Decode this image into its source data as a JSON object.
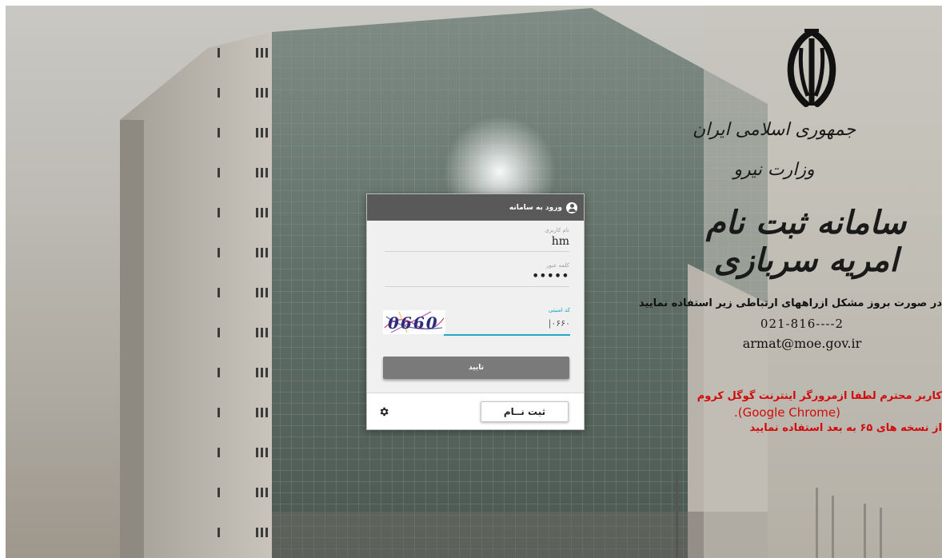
{
  "branding": {
    "republic": "جمهوری اسلامی ایران",
    "ministry": "وزارت نیرو",
    "system_title": "سامانه ثبت نام امریه سربازی",
    "emblem_icon": "iran-emblem-icon"
  },
  "help": {
    "message": "در صورت بروز مشکل ازراههای ارتباطی زیر استفاده نمایید",
    "phone": "021-816----2",
    "email": "armat@moe.gov.ir"
  },
  "warning": {
    "line1": "کاربر محترم لطفا ازمرورگر اینترنت گوگل کروم",
    "line2": ".(Google Chrome)",
    "line3": "از نسخه های ۶۵ به بعد استفاده نمایید",
    "color": "#d10b0b"
  },
  "login": {
    "title": "ورود به سامانه",
    "username_label": "نام کاربری",
    "username_value": "hm",
    "password_label": "کلمه عبور",
    "password_value": "•••••",
    "captcha_label": "کد امنیتی",
    "captcha_value": "|۰۶۶۰",
    "captcha_image_text": "0660",
    "submit_label": "تایید",
    "register_label": "ثبت نــام",
    "settings_icon": "gear-icon",
    "accent_color": "#23a8c9"
  }
}
